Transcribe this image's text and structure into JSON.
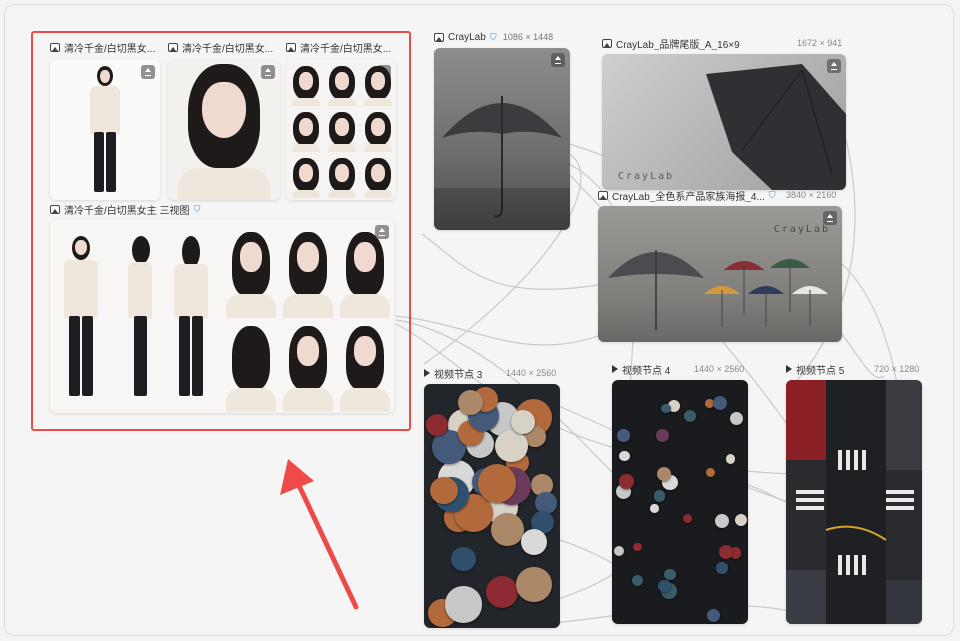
{
  "canvas": {
    "accent": "#ef4a4a",
    "background": "#f5f5f5"
  },
  "nodes": {
    "char1": {
      "title": "清冷千金/白切黑女...",
      "icon": "image-icon"
    },
    "char2": {
      "title": "清冷千金/白切黑女...",
      "icon": "image-icon"
    },
    "char3": {
      "title": "清冷千金/白切黑女...",
      "icon": "image-icon"
    },
    "char4": {
      "title": "清冷千金/白切黑女主 三视图",
      "icon": "image-icon",
      "badge": "verified-icon"
    },
    "umbrella1": {
      "title": "CrayLab",
      "dims": "1086 × 1448",
      "icon": "image-icon",
      "badge": "verified-icon"
    },
    "brand": {
      "title": "CrayLab_品牌尾版_A_16×9",
      "dims": "1672 × 941",
      "watermark": "CrayLab",
      "icon": "image-icon"
    },
    "family": {
      "title": "CrayLab_全色系产品家族海报_4...",
      "dims": "3840 × 2160",
      "watermark": "CrayLab",
      "icon": "image-icon",
      "badge": "verified-icon"
    },
    "video3": {
      "title": "视频节点 3",
      "dims": "1440 × 2560",
      "icon": "play-icon"
    },
    "video4": {
      "title": "视频节点 4",
      "dims": "1440 × 2560",
      "icon": "play-icon"
    },
    "video5": {
      "title": "视频节点 5",
      "dims": "720 × 1280",
      "icon": "play-icon"
    }
  }
}
